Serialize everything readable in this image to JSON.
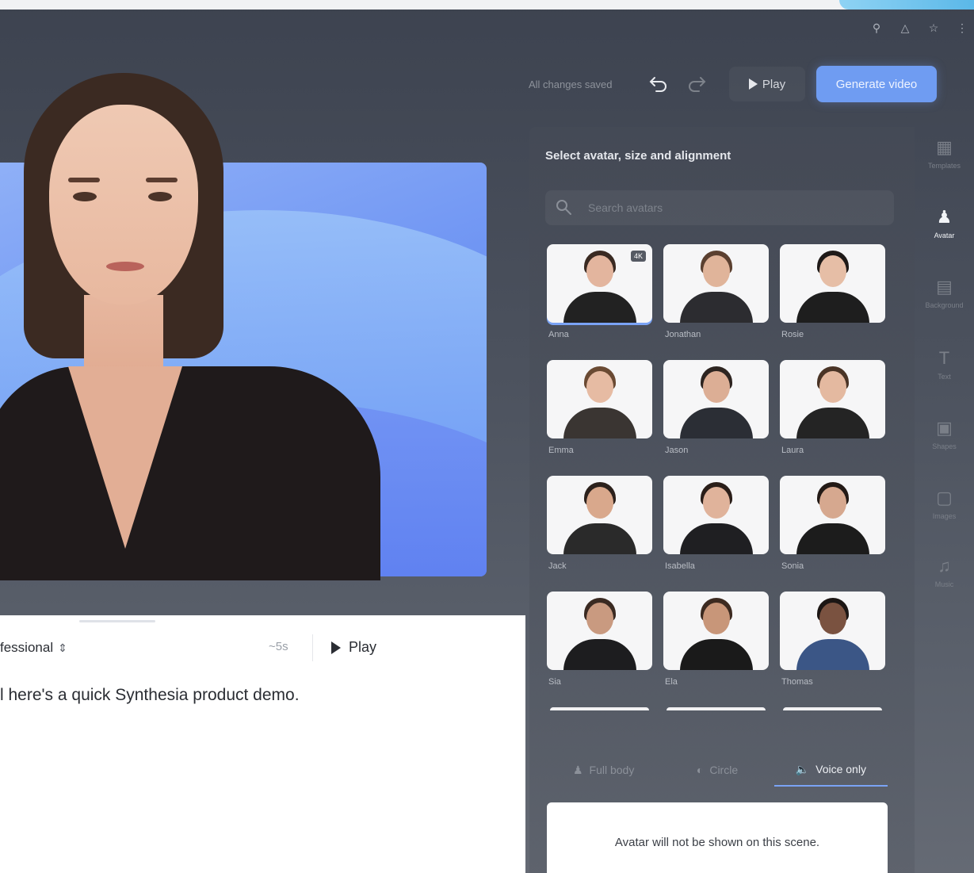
{
  "header": {
    "saved_status": "All changes saved",
    "play_label": "Play",
    "generate_label": "Generate video"
  },
  "script": {
    "voice": "fessional",
    "duration": "~5s",
    "play_label": "Play",
    "text": "l here's a quick Synthesia product demo."
  },
  "avatar_panel": {
    "title": "Select avatar, size and alignment",
    "search_placeholder": "Search avatars",
    "badge": "4K",
    "avatars": [
      {
        "name": "Anna"
      },
      {
        "name": "Jonathan"
      },
      {
        "name": "Rosie"
      },
      {
        "name": "Emma"
      },
      {
        "name": "Jason"
      },
      {
        "name": "Laura"
      },
      {
        "name": "Jack"
      },
      {
        "name": "Isabella"
      },
      {
        "name": "Sonia"
      },
      {
        "name": "Sia"
      },
      {
        "name": "Ela"
      },
      {
        "name": "Thomas"
      }
    ],
    "tabs": [
      {
        "label": "Full body"
      },
      {
        "label": "Circle"
      },
      {
        "label": "Voice only"
      }
    ],
    "voice_only_message": "Avatar will not be shown on this scene."
  },
  "sidebar": {
    "items": [
      {
        "label": "Templates"
      },
      {
        "label": "Avatar"
      },
      {
        "label": "Background"
      },
      {
        "label": "Text"
      },
      {
        "label": "Shapes"
      },
      {
        "label": "Images"
      },
      {
        "label": "Music"
      }
    ]
  },
  "colors": {
    "accent": "#6f9cf2",
    "canvas_bg": "#6f95f3",
    "panel_bg": "#4b515d"
  }
}
